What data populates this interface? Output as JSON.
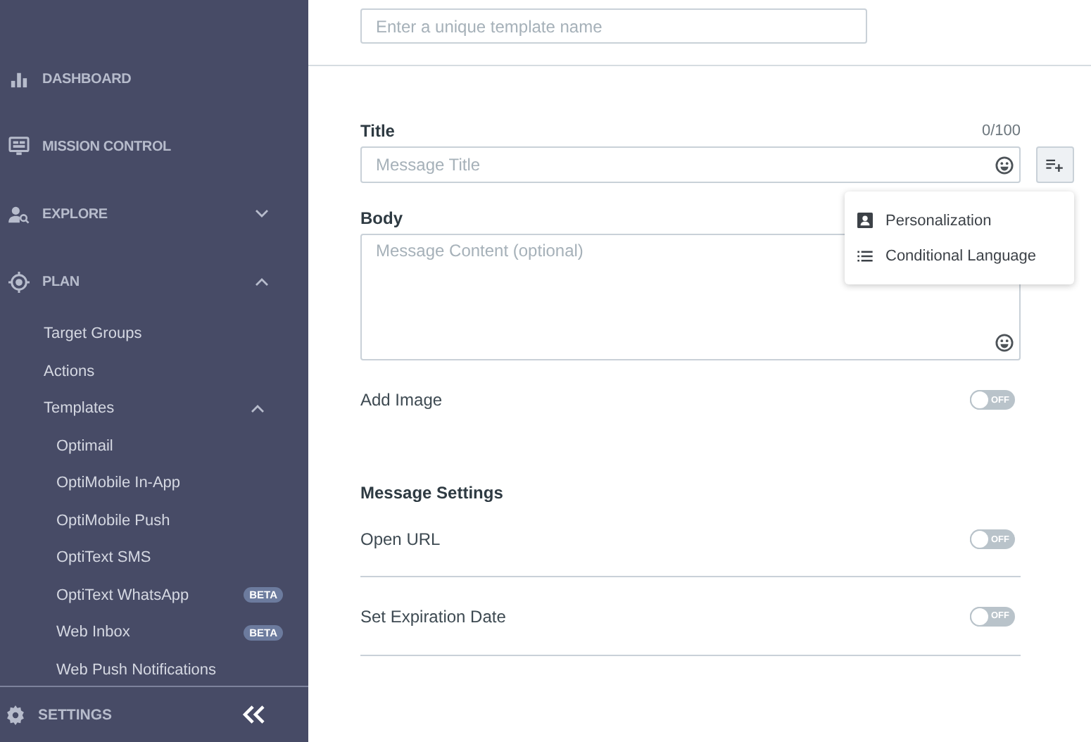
{
  "sidebar": {
    "items": [
      {
        "label": "DASHBOARD"
      },
      {
        "label": "MISSION CONTROL"
      },
      {
        "label": "EXPLORE",
        "expanded": false
      },
      {
        "label": "PLAN",
        "expanded": true,
        "children": [
          {
            "label": "Target Groups"
          },
          {
            "label": "Actions"
          },
          {
            "label": "Templates",
            "expanded": true,
            "children": [
              {
                "label": "Optimail"
              },
              {
                "label": "OptiMobile In-App"
              },
              {
                "label": "OptiMobile Push"
              },
              {
                "label": "OptiText SMS"
              },
              {
                "label": "OptiText WhatsApp",
                "badge": "BETA"
              },
              {
                "label": "Web Inbox",
                "badge": "BETA"
              },
              {
                "label": "Web Push Notifications"
              }
            ]
          }
        ]
      }
    ],
    "footer": {
      "label": "SETTINGS"
    }
  },
  "template_name": {
    "placeholder": "Enter a unique template name"
  },
  "title": {
    "label": "Title",
    "counter": "0/100",
    "placeholder": "Message Title"
  },
  "insert_menu": {
    "open": true,
    "items": [
      {
        "label": "Personalization"
      },
      {
        "label": "Conditional Language"
      }
    ]
  },
  "body": {
    "label": "Body",
    "placeholder": "Message Content (optional)"
  },
  "add_image": {
    "label": "Add Image",
    "on": false,
    "toggle_text": "OFF"
  },
  "message_settings": {
    "heading": "Message Settings",
    "rows": [
      {
        "label": "Open URL",
        "on": false,
        "toggle_text": "OFF"
      },
      {
        "label": "Set Expiration Date",
        "on": false,
        "toggle_text": "OFF"
      }
    ]
  }
}
